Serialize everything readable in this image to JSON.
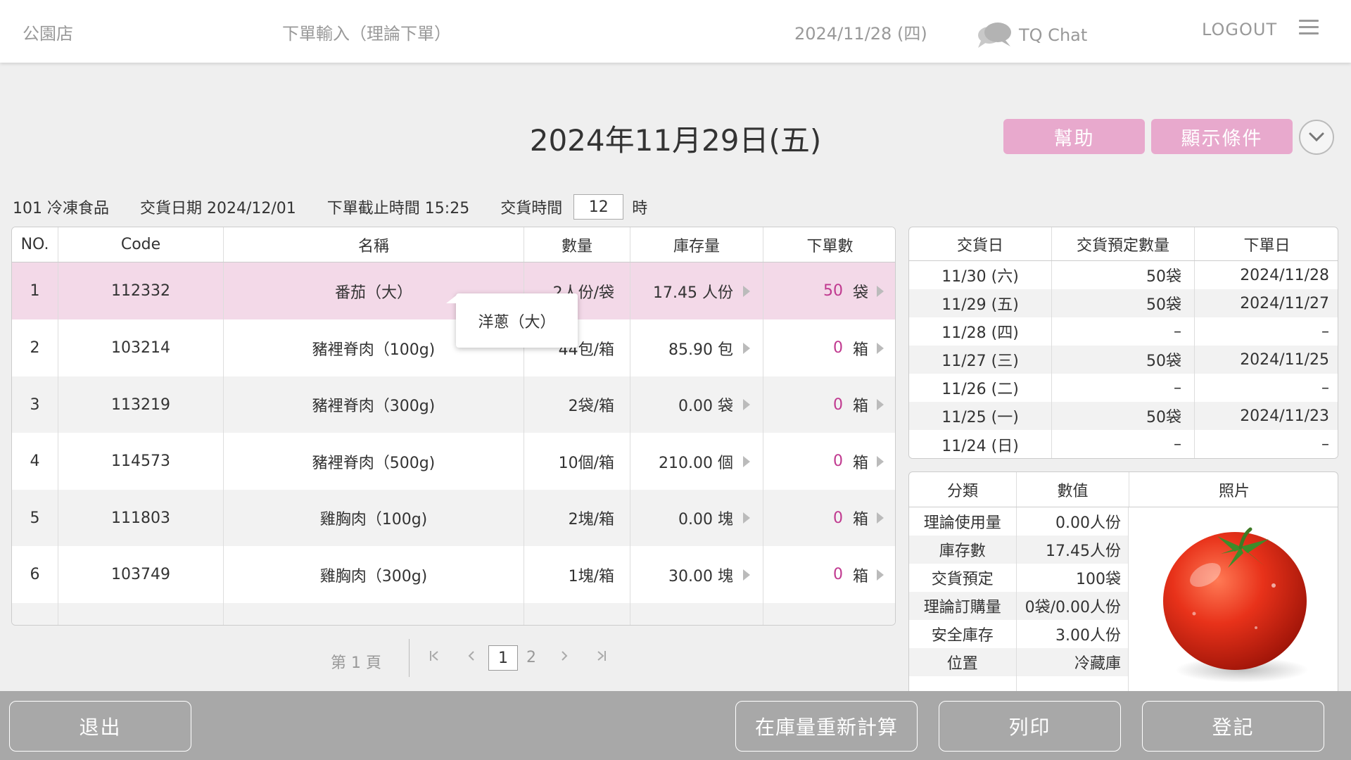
{
  "header": {
    "store": "公園店",
    "page": "下單輸入（理論下單）",
    "date": "2024/11/28 (四)",
    "chat": "TQ Chat",
    "logout": "LOGOUT"
  },
  "title": "2024年11月29日(五)",
  "buttons": {
    "help": "幫助",
    "conditions": "顯示條件"
  },
  "info": {
    "category": "101 冷凍食品",
    "delivery_date": "交貨日期 2024/12/01",
    "cutoff": "下單截止時間 15:25",
    "delivery_time_label": "交貨時間",
    "delivery_hour": "12",
    "hour_unit": "時"
  },
  "main_table": {
    "headers": [
      "NO.",
      "Code",
      "名稱",
      "數量",
      "庫存量",
      "下單數"
    ],
    "rows": [
      {
        "no": "1",
        "code": "112332",
        "name": "番茄（大）",
        "qty": "2人份/袋",
        "stock": "17.45 人份",
        "order": "50",
        "unit": "袋"
      },
      {
        "no": "2",
        "code": "103214",
        "name": "豬裡脊肉（100g)",
        "qty": "44包/箱",
        "stock": "85.90 包",
        "order": "0",
        "unit": "箱"
      },
      {
        "no": "3",
        "code": "113219",
        "name": "豬裡脊肉（300g)",
        "qty": "2袋/箱",
        "stock": "0.00 袋",
        "order": "0",
        "unit": "箱"
      },
      {
        "no": "4",
        "code": "114573",
        "name": "豬裡脊肉（500g)",
        "qty": "10個/箱",
        "stock": "210.00 個",
        "order": "0",
        "unit": "箱"
      },
      {
        "no": "5",
        "code": "111803",
        "name": "雞胸肉（100g)",
        "qty": "2塊/箱",
        "stock": "0.00 塊",
        "order": "0",
        "unit": "箱"
      },
      {
        "no": "6",
        "code": "103749",
        "name": "雞胸肉（300g)",
        "qty": "1塊/箱",
        "stock": "30.00 塊",
        "order": "0",
        "unit": "箱"
      }
    ]
  },
  "tooltip": "洋蔥（大）",
  "pagination": {
    "label": "第 1 頁",
    "current": "1",
    "next": "2"
  },
  "delivery_table": {
    "headers": [
      "交貨日",
      "交貨預定數量",
      "下單日"
    ],
    "rows": [
      [
        "11/30 (六)",
        "50袋",
        "2024/11/28"
      ],
      [
        "11/29 (五)",
        "50袋",
        "2024/11/27"
      ],
      [
        "11/28 (四)",
        "–",
        "–"
      ],
      [
        "11/27 (三)",
        "50袋",
        "2024/11/25"
      ],
      [
        "11/26 (二)",
        "–",
        "–"
      ],
      [
        "11/25 (一)",
        "50袋",
        "2024/11/23"
      ],
      [
        "11/24 (日)",
        "–",
        "–"
      ]
    ]
  },
  "info_table": {
    "headers": [
      "分類",
      "數值",
      "照片"
    ],
    "rows": [
      [
        "理論使用量",
        "0.00人份"
      ],
      [
        "庫存數",
        "17.45人份"
      ],
      [
        "交貨預定",
        "100袋"
      ],
      [
        "理論訂購量",
        "0袋/0.00人份"
      ],
      [
        "安全庫存",
        "3.00人份"
      ],
      [
        "位置",
        "冷藏庫"
      ]
    ]
  },
  "footer": {
    "exit": "退出",
    "recalc": "在庫量重新計算",
    "print": "列印",
    "register": "登記"
  },
  "colors": {
    "accent_pink": "#e8a9cd",
    "selected_row": "#f3d9e8",
    "order_number": "#c0398f",
    "footer_gray": "#a8a8a8"
  }
}
